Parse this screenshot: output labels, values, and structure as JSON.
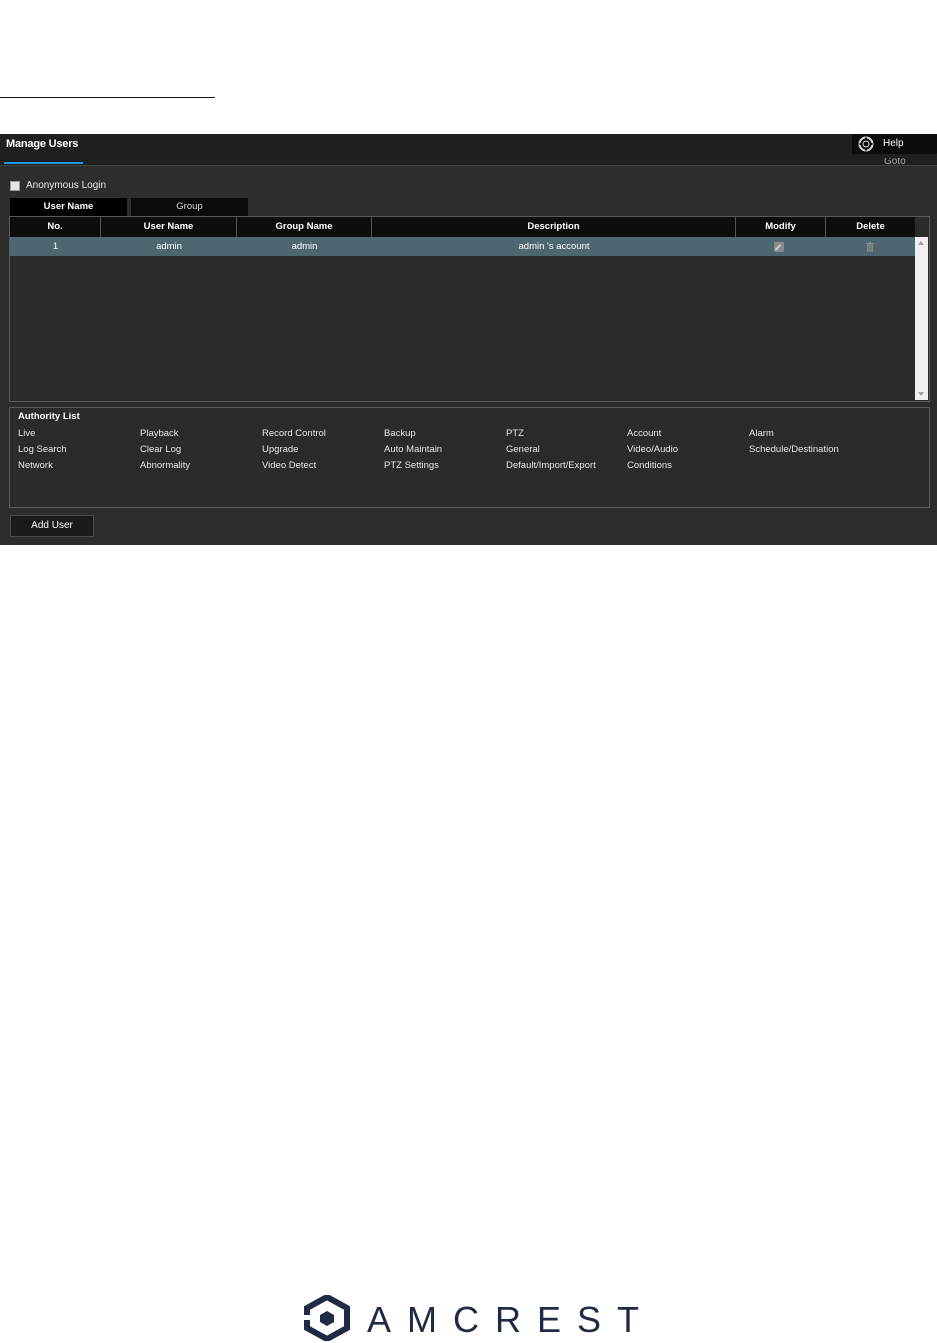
{
  "header": {
    "title": "Manage Users",
    "help_label": "Help",
    "cut_text": "Goto"
  },
  "anonymous_login": {
    "label": "Anonymous Login",
    "checked": false
  },
  "tabs": [
    {
      "label": "User Name",
      "active": true
    },
    {
      "label": "Group",
      "active": false
    }
  ],
  "table": {
    "columns": [
      "No.",
      "User Name",
      "Group Name",
      "Description",
      "Modify",
      "Delete"
    ],
    "rows": [
      {
        "no": "1",
        "user_name": "admin",
        "group_name": "admin",
        "description": "admin 's account",
        "modify_icon": "pencil-icon",
        "delete_icon": "trash-icon"
      }
    ],
    "selected_row_color": "#4d6670"
  },
  "authority": {
    "title": "Authority List",
    "items": [
      "Live",
      "Playback",
      "Record Control",
      "Backup",
      "PTZ",
      "Account",
      "Alarm",
      "Log Search",
      "Clear Log",
      "Upgrade",
      "Auto Maintain",
      "General",
      "Video/Audio",
      "Schedule/Destination",
      "Network",
      "Abnormality",
      "Video Detect",
      "PTZ Settings",
      "Default/Import/Export",
      "Conditions"
    ]
  },
  "add_user_label": "Add User",
  "logo": {
    "text": "AMCREST",
    "color": "#1f2a44"
  },
  "colors": {
    "accent": "#1e9ad6",
    "panel_bg": "#2d2d2d"
  }
}
